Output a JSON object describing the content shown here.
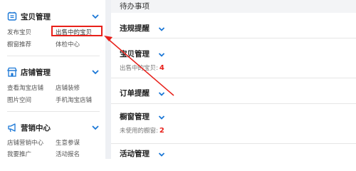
{
  "sidebar": {
    "sections": [
      {
        "title": "宝贝管理",
        "icon": "tag-icon",
        "links": [
          "发布宝贝",
          "出售中的宝贝",
          "橱窗推荐",
          "体检中心"
        ]
      },
      {
        "title": "店铺管理",
        "icon": "store-icon",
        "links": [
          "查看淘宝店铺",
          "店铺装修",
          "图片空间",
          "手机淘宝店铺"
        ]
      },
      {
        "title": "营销中心",
        "icon": "megaphone-icon",
        "links": [
          "店铺营销中心",
          "生意参谋",
          "我要推广",
          "活动报名"
        ]
      }
    ],
    "selected_link": "出售中的宝贝"
  },
  "main": {
    "header": "待办事项",
    "rows": [
      {
        "title": "违规提醒"
      },
      {
        "title": "宝贝管理",
        "sub_label": "出售中的宝贝:",
        "sub_value": "4"
      },
      {
        "title": "订单提醒"
      },
      {
        "title": "橱窗管理",
        "sub_label": "未使用的橱窗:",
        "sub_value": "2"
      },
      {
        "title": "活动管理"
      }
    ]
  },
  "colors": {
    "accent_blue": "#1a77d6",
    "highlight_red": "#e8201a"
  }
}
